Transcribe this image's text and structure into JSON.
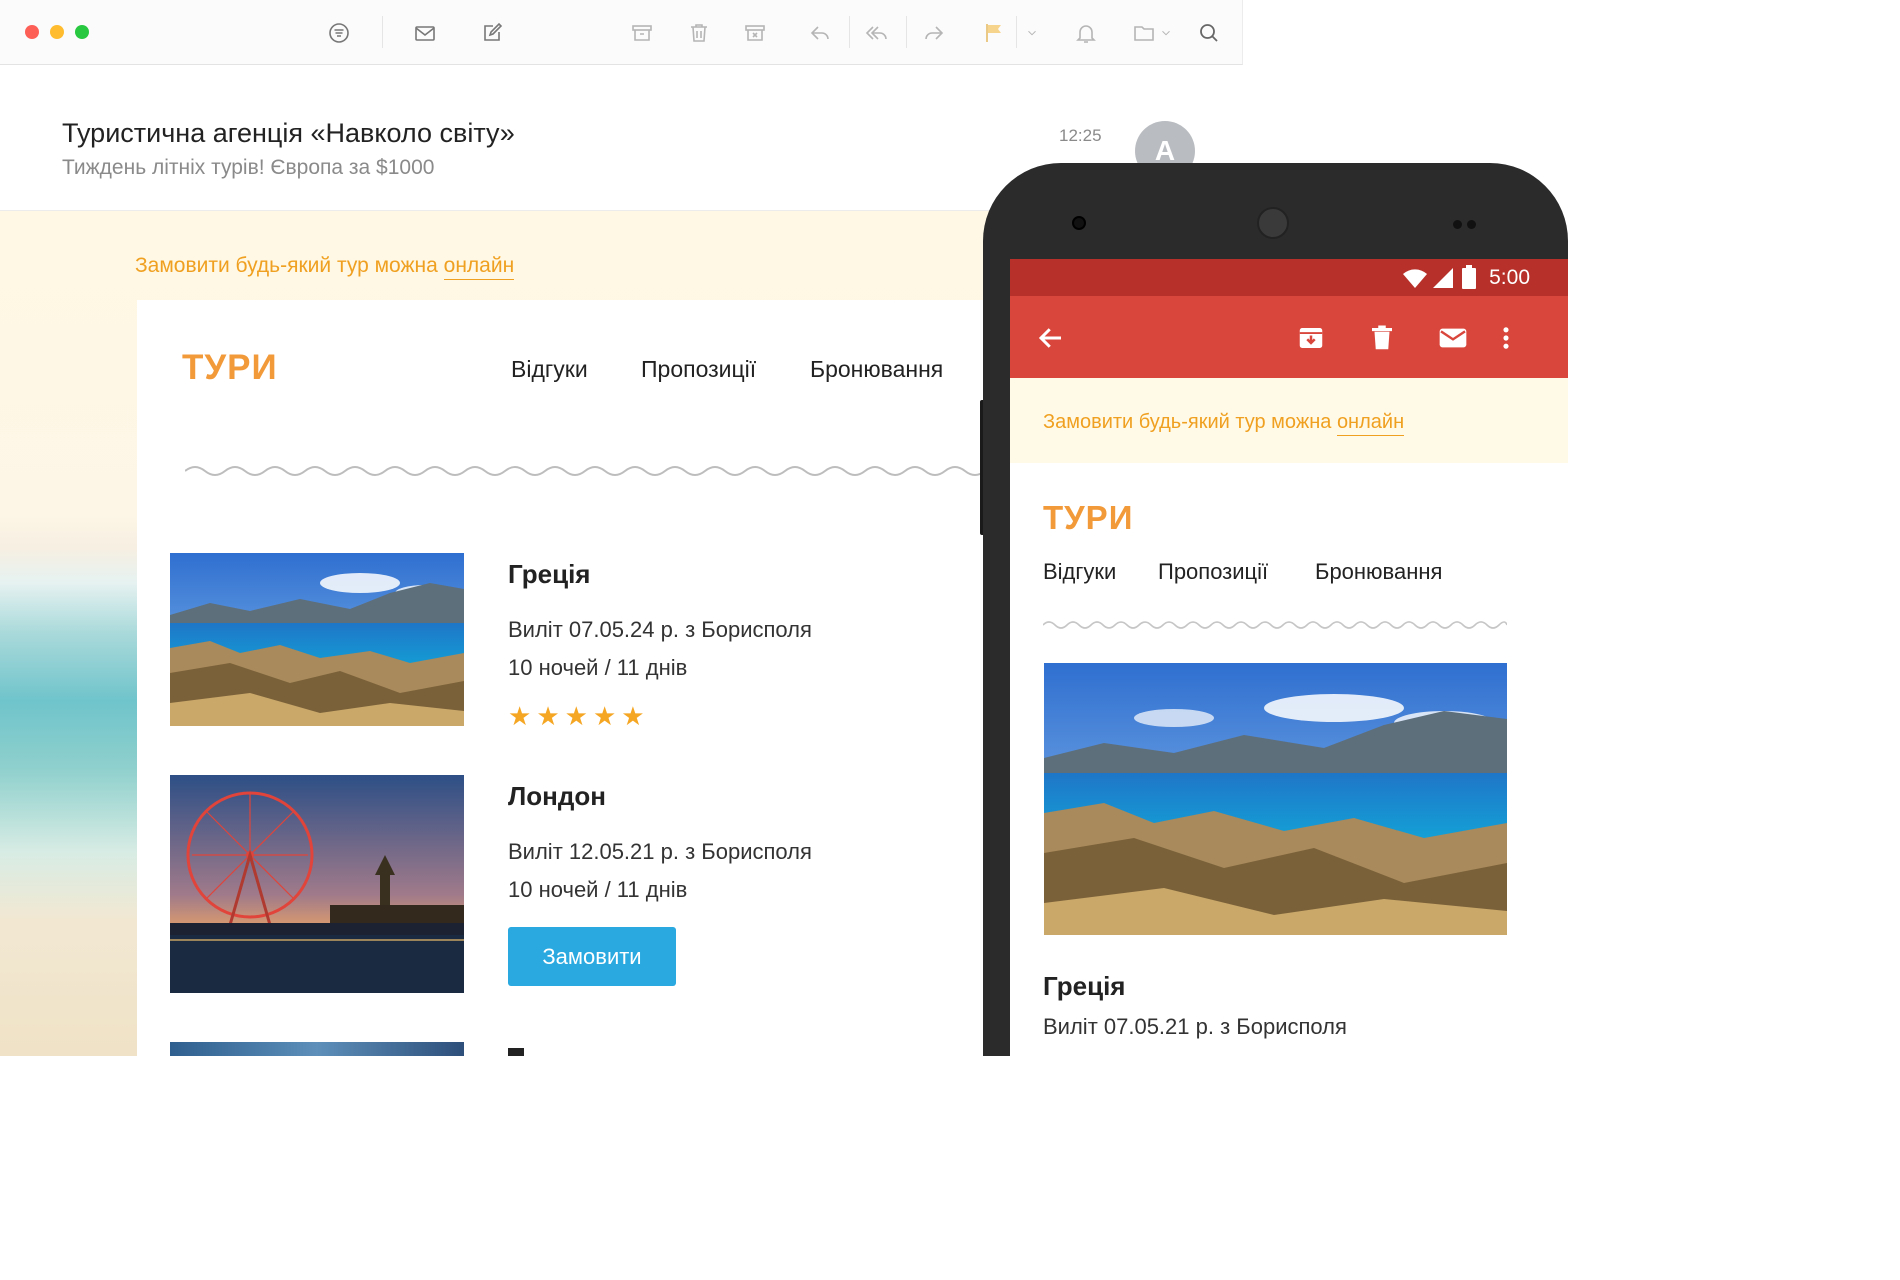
{
  "desktop": {
    "toolbar": {
      "icons": [
        "list-filter-icon",
        "envelope-icon",
        "compose-icon",
        "archive-icon",
        "trash-icon",
        "spam-icon",
        "reply-icon",
        "reply-all-icon",
        "forward-icon",
        "flag-icon",
        "chevron-down-icon",
        "bell-icon",
        "folder-icon",
        "search-icon"
      ]
    },
    "message": {
      "sender": "Туристична агенція «Навколо світу»",
      "subject": "Тиждень літніх турів! Європа за $1000",
      "time": "12:25",
      "avatar_letter": "A"
    },
    "promo": {
      "text": "Замовити будь-який тур можна ",
      "link": "онлайн"
    },
    "logo": "ТУРИ",
    "nav": [
      "Відгуки",
      "Пропозиції",
      "Бронювання"
    ],
    "tours": [
      {
        "title": "Греція",
        "departure": "Виліт 07.05.24 р. з Борисполя",
        "duration": "10 ночей / 11 днів",
        "rating": 5
      },
      {
        "title": "Лондон",
        "departure": "Виліт 12.05.21 р. з Борисполя",
        "duration": "10 ночей / 11 днів",
        "button": "Замовити"
      }
    ]
  },
  "mobile": {
    "status_time": "5:00",
    "promo": {
      "text": "Замовити будь-який тур можна ",
      "link": "онлайн"
    },
    "logo": "ТУРИ",
    "nav": [
      "Відгуки",
      "Пропозиції",
      "Бронювання"
    ],
    "tour": {
      "title": "Греція",
      "departure": "Виліт 07.05.21 р. з Борисполя"
    }
  },
  "colors": {
    "accent_orange": "#f29a3a",
    "promo_orange": "#f0a020",
    "button_blue": "#29a9e0",
    "gmail_red": "#d9463c",
    "status_red": "#b7312a"
  }
}
